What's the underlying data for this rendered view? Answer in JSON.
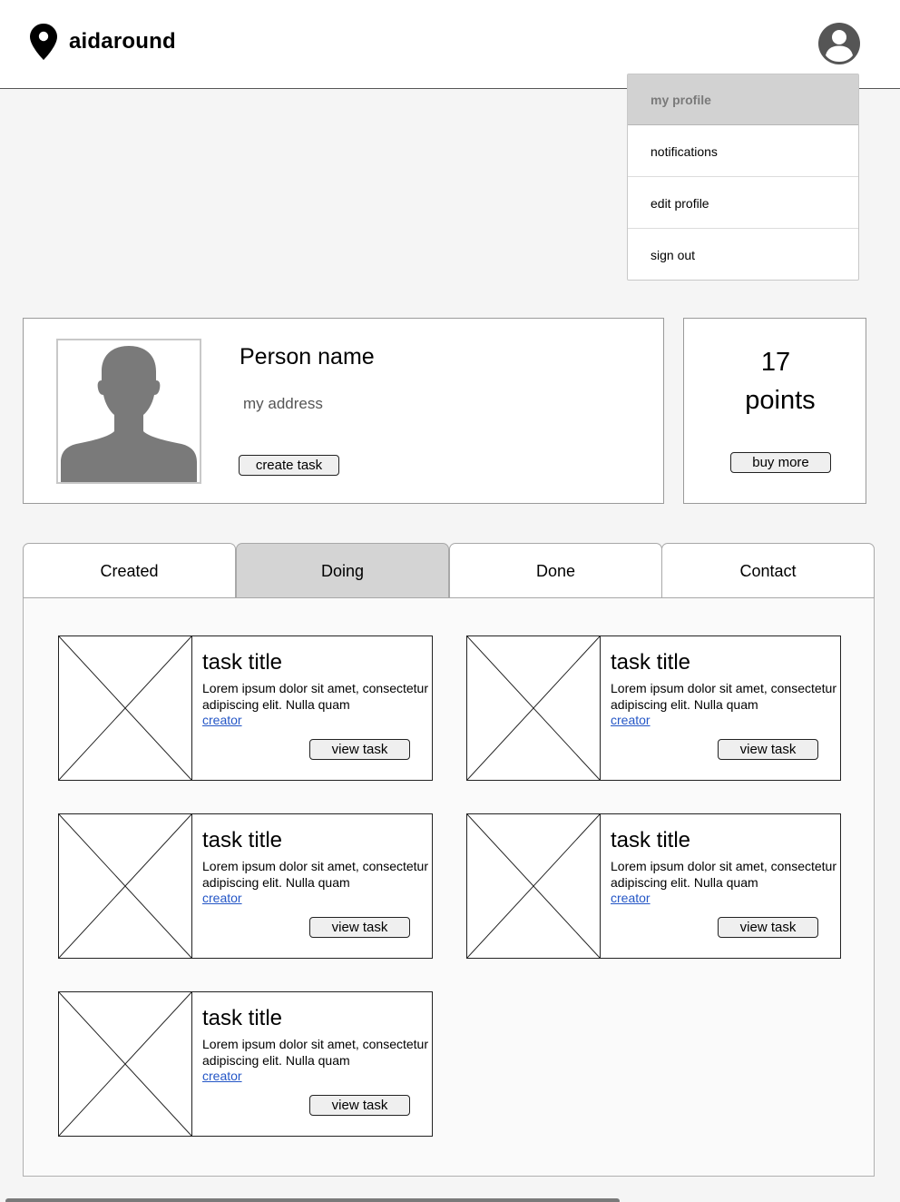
{
  "app": {
    "name": "aidaround"
  },
  "menu": {
    "items": [
      {
        "label": "my profile"
      },
      {
        "label": "notifications"
      },
      {
        "label": "edit profile"
      },
      {
        "label": "sign out"
      }
    ]
  },
  "profile": {
    "name": "Person name",
    "address": "my address",
    "create_task_label": "create task"
  },
  "points": {
    "value": "17",
    "label": "points",
    "buy_more_label": "buy more"
  },
  "tabs": [
    {
      "label": "Created"
    },
    {
      "label": "Doing"
    },
    {
      "label": "Done"
    },
    {
      "label": "Contact"
    }
  ],
  "active_tab": "Doing",
  "tasks": [
    {
      "title": "task title",
      "description": "Lorem ipsum dolor sit amet, consectetur adipiscing elit. Nulla quam",
      "creator": "creator",
      "button": "view task"
    },
    {
      "title": "task title",
      "description": "Lorem ipsum dolor sit amet, consectetur adipiscing elit. Nulla quam",
      "creator": "creator",
      "button": "view task"
    },
    {
      "title": "task title",
      "description": "Lorem ipsum dolor sit amet, consectetur adipiscing elit. Nulla quam",
      "creator": "creator",
      "button": "view task"
    },
    {
      "title": "task title",
      "description": "Lorem ipsum dolor sit amet, consectetur adipiscing elit. Nulla quam",
      "creator": "creator",
      "button": "view task"
    },
    {
      "title": "task title",
      "description": "Lorem ipsum dolor sit amet, consectetur adipiscing elit. Nulla quam",
      "creator": "creator",
      "button": "view task"
    }
  ],
  "icons": {
    "logo": "map-pin-icon",
    "account": "account-circle-icon",
    "photo": "person-silhouette-icon",
    "task_image": "image-placeholder-icon"
  }
}
